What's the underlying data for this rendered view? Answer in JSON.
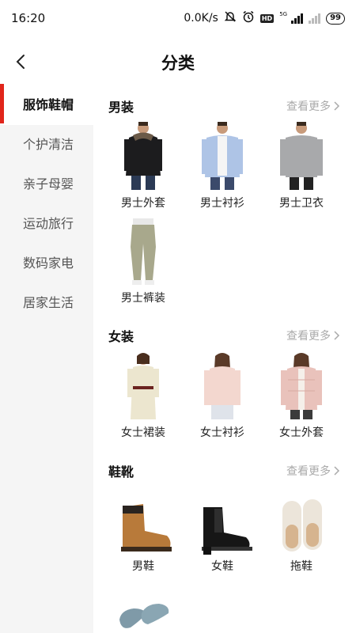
{
  "status": {
    "time": "16:20",
    "speed": "0.0K/s",
    "hd": "HD",
    "gen": "5G",
    "battery": "99"
  },
  "header": {
    "title": "分类"
  },
  "sidebar": {
    "items": [
      {
        "label": "服饰鞋帽"
      },
      {
        "label": "个护清洁"
      },
      {
        "label": "亲子母婴"
      },
      {
        "label": "运动旅行"
      },
      {
        "label": "数码家电"
      },
      {
        "label": "居家生活"
      }
    ]
  },
  "sections": [
    {
      "title": "男装",
      "more": "查看更多",
      "items": [
        {
          "label": "男士外套",
          "icon": "men-jacket-image"
        },
        {
          "label": "男士衬衫",
          "icon": "men-shirt-image"
        },
        {
          "label": "男士卫衣",
          "icon": "men-sweatshirt-image"
        },
        {
          "label": "男士裤装",
          "icon": "men-pants-image"
        }
      ]
    },
    {
      "title": "女装",
      "more": "查看更多",
      "items": [
        {
          "label": "女士裙装",
          "icon": "women-dress-image"
        },
        {
          "label": "女士衬衫",
          "icon": "women-shirt-image"
        },
        {
          "label": "女士外套",
          "icon": "women-jacket-image"
        }
      ]
    },
    {
      "title": "鞋靴",
      "more": "查看更多",
      "items": [
        {
          "label": "男鞋",
          "icon": "men-boot-image"
        },
        {
          "label": "女鞋",
          "icon": "women-boot-image"
        },
        {
          "label": "拖鞋",
          "icon": "slipper-image"
        },
        {
          "label": "",
          "icon": "insole-image"
        }
      ]
    }
  ],
  "colors": {
    "accent": "#e1251b",
    "sidebar_bg": "#f5f5f5",
    "more_text": "#aaaaaa"
  }
}
